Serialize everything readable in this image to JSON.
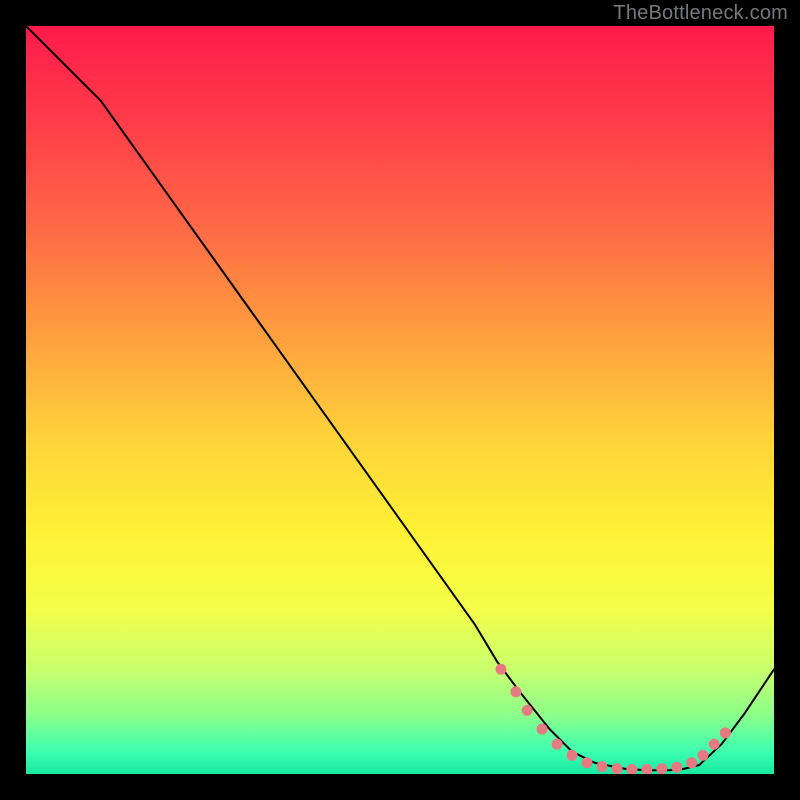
{
  "attribution": "TheBottleneck.com",
  "chart_data": {
    "type": "line",
    "title": "",
    "xlabel": "",
    "ylabel": "",
    "xlim": [
      0,
      100
    ],
    "ylim": [
      0,
      100
    ],
    "grid": false,
    "legend": false,
    "series": [
      {
        "name": "curve",
        "x": [
          0,
          3,
          6,
          10,
          15,
          20,
          25,
          30,
          35,
          40,
          45,
          50,
          55,
          60,
          63,
          66,
          70,
          73,
          76,
          80,
          83,
          86,
          88,
          90,
          93,
          96,
          100
        ],
        "y": [
          100,
          97,
          94,
          90,
          83,
          76,
          69,
          62,
          55,
          48,
          41,
          34,
          27,
          20,
          15,
          11,
          6,
          3,
          1.5,
          0.7,
          0.5,
          0.5,
          0.7,
          1.2,
          4,
          8,
          14
        ]
      }
    ],
    "markers": {
      "name": "dots",
      "color": "#e67a80",
      "x": [
        63.5,
        65.5,
        67,
        69,
        71,
        73,
        75,
        77,
        79,
        81,
        83,
        85,
        87,
        89,
        90.5,
        92,
        93.5
      ],
      "y": [
        14,
        11,
        8.5,
        6,
        4,
        2.5,
        1.5,
        1,
        0.7,
        0.6,
        0.6,
        0.7,
        0.9,
        1.5,
        2.5,
        4,
        5.5
      ]
    },
    "background_gradient": {
      "stops": [
        {
          "offset": 0.0,
          "color": "#ff1b4b"
        },
        {
          "offset": 0.12,
          "color": "#ff3a49"
        },
        {
          "offset": 0.25,
          "color": "#ff6247"
        },
        {
          "offset": 0.4,
          "color": "#ff9a3f"
        },
        {
          "offset": 0.55,
          "color": "#ffd23a"
        },
        {
          "offset": 0.68,
          "color": "#fff236"
        },
        {
          "offset": 0.78,
          "color": "#f3ff4a"
        },
        {
          "offset": 0.86,
          "color": "#c9ff6e"
        },
        {
          "offset": 0.92,
          "color": "#8dff8a"
        },
        {
          "offset": 0.97,
          "color": "#3dffb0"
        },
        {
          "offset": 1.0,
          "color": "#17e8a2"
        }
      ]
    }
  }
}
